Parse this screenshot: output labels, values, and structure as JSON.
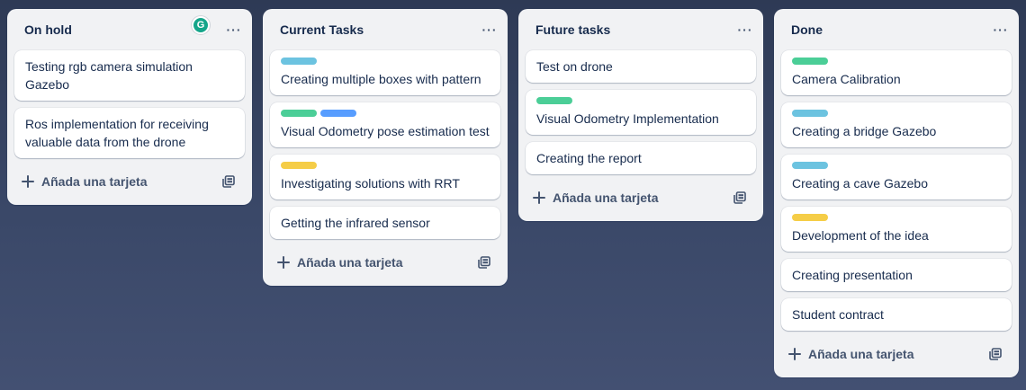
{
  "colors": {
    "green": "#4bce97",
    "blue": "#579dff",
    "sky": "#6cc3e0",
    "yellow": "#f5cd47"
  },
  "lists": [
    {
      "title": "On hold",
      "menu": "···",
      "grammarly_badge": "G",
      "add_label": "Añada una tarjeta",
      "cards": [
        {
          "title": "Testing rgb camera simulation Gazebo"
        },
        {
          "title": "Ros implementation for receiving valuable data from the drone"
        }
      ]
    },
    {
      "title": "Current Tasks",
      "menu": "···",
      "add_label": "Añada una tarjeta",
      "cards": [
        {
          "title": "Creating multiple boxes with pattern",
          "labels": [
            "sky"
          ]
        },
        {
          "title": "Visual Odometry pose estimation test",
          "labels": [
            "green",
            "blue"
          ]
        },
        {
          "title": "Investigating solutions with RRT",
          "labels": [
            "yellow"
          ]
        },
        {
          "title": "Getting the infrared sensor"
        }
      ]
    },
    {
      "title": "Future tasks",
      "menu": "···",
      "add_label": "Añada una tarjeta",
      "cards": [
        {
          "title": "Test on drone"
        },
        {
          "title": "Visual Odometry Implementation",
          "labels": [
            "green"
          ]
        },
        {
          "title": "Creating the report"
        }
      ]
    },
    {
      "title": "Done",
      "menu": "···",
      "add_label": "Añada una tarjeta",
      "cards": [
        {
          "title": "Camera Calibration",
          "labels": [
            "green"
          ]
        },
        {
          "title": "Creating a bridge Gazebo",
          "labels": [
            "sky"
          ]
        },
        {
          "title": "Creating a cave Gazebo",
          "labels": [
            "sky"
          ]
        },
        {
          "title": "Development of the idea",
          "labels": [
            "yellow"
          ]
        },
        {
          "title": "Creating presentation"
        },
        {
          "title": "Student contract"
        }
      ]
    }
  ]
}
